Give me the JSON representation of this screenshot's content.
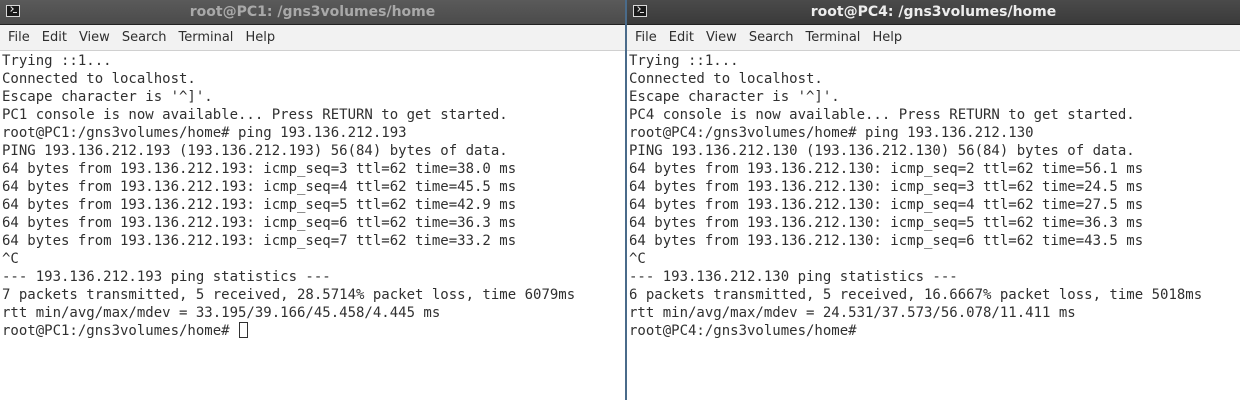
{
  "windows": [
    {
      "title": "root@PC1: /gns3volumes/home",
      "active": false,
      "menu": [
        "File",
        "Edit",
        "View",
        "Search",
        "Terminal",
        "Help"
      ],
      "lines": [
        "Trying ::1...",
        "Connected to localhost.",
        "Escape character is '^]'.",
        "PC1 console is now available... Press RETURN to get started.",
        "root@PC1:/gns3volumes/home# ping 193.136.212.193",
        "PING 193.136.212.193 (193.136.212.193) 56(84) bytes of data.",
        "64 bytes from 193.136.212.193: icmp_seq=3 ttl=62 time=38.0 ms",
        "64 bytes from 193.136.212.193: icmp_seq=4 ttl=62 time=45.5 ms",
        "64 bytes from 193.136.212.193: icmp_seq=5 ttl=62 time=42.9 ms",
        "64 bytes from 193.136.212.193: icmp_seq=6 ttl=62 time=36.3 ms",
        "64 bytes from 193.136.212.193: icmp_seq=7 ttl=62 time=33.2 ms",
        "^C",
        "--- 193.136.212.193 ping statistics ---",
        "7 packets transmitted, 5 received, 28.5714% packet loss, time 6079ms",
        "rtt min/avg/max/mdev = 33.195/39.166/45.458/4.445 ms"
      ],
      "prompt": "root@PC1:/gns3volumes/home# ",
      "cursor_visible": true
    },
    {
      "title": "root@PC4: /gns3volumes/home",
      "active": true,
      "menu": [
        "File",
        "Edit",
        "View",
        "Search",
        "Terminal",
        "Help"
      ],
      "lines": [
        "Trying ::1...",
        "Connected to localhost.",
        "Escape character is '^]'.",
        "PC4 console is now available... Press RETURN to get started.",
        "root@PC4:/gns3volumes/home# ping 193.136.212.130",
        "PING 193.136.212.130 (193.136.212.130) 56(84) bytes of data.",
        "64 bytes from 193.136.212.130: icmp_seq=2 ttl=62 time=56.1 ms",
        "64 bytes from 193.136.212.130: icmp_seq=3 ttl=62 time=24.5 ms",
        "64 bytes from 193.136.212.130: icmp_seq=4 ttl=62 time=27.5 ms",
        "64 bytes from 193.136.212.130: icmp_seq=5 ttl=62 time=36.3 ms",
        "64 bytes from 193.136.212.130: icmp_seq=6 ttl=62 time=43.5 ms",
        "^C",
        "--- 193.136.212.130 ping statistics ---",
        "6 packets transmitted, 5 received, 16.6667% packet loss, time 5018ms",
        "rtt min/avg/max/mdev = 24.531/37.573/56.078/11.411 ms"
      ],
      "prompt": "root@PC4:/gns3volumes/home#",
      "cursor_visible": false
    }
  ]
}
